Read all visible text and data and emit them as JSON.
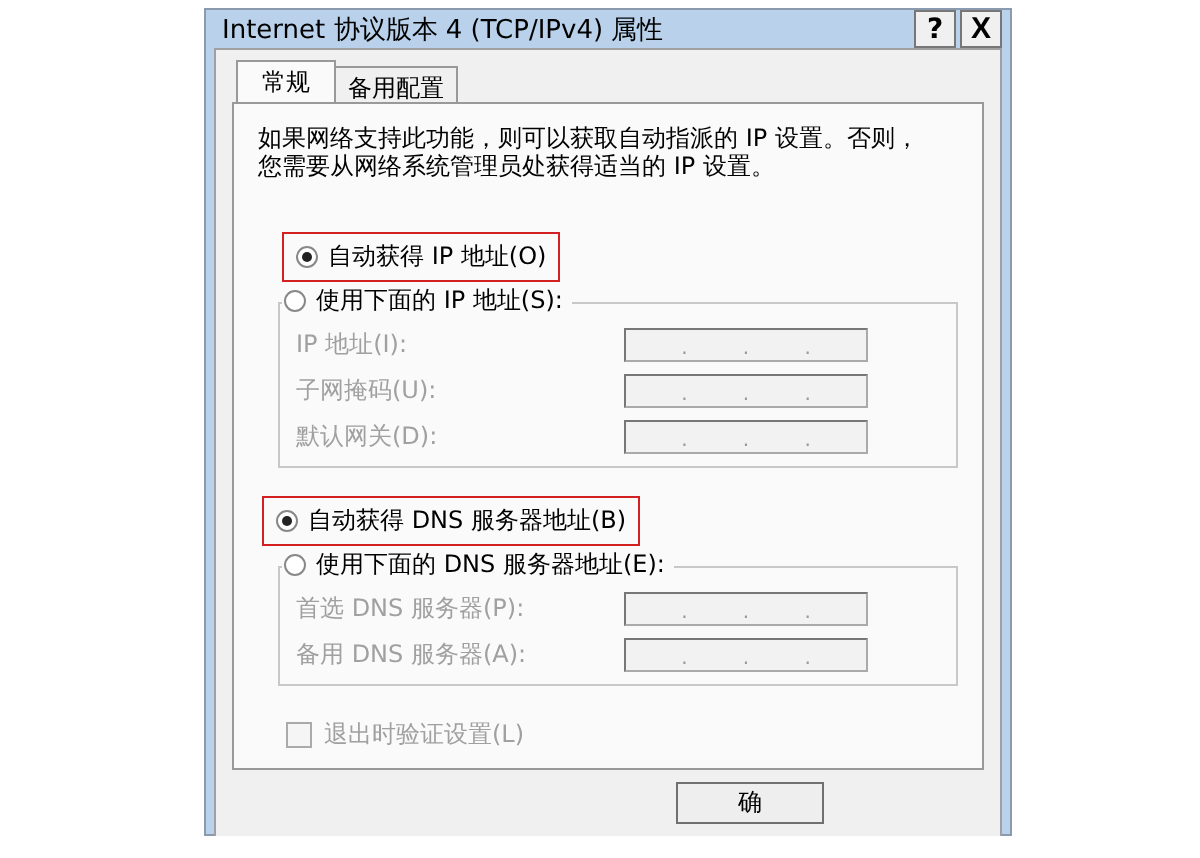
{
  "window": {
    "title": "Internet 协议版本 4 (TCP/IPv4) 属性",
    "buttons": [
      {
        "kind": "help",
        "label": "?"
      },
      {
        "kind": "close",
        "label": "X"
      }
    ]
  },
  "tabs": [
    {
      "label": "常规",
      "selected": true
    },
    {
      "label": "备用配置",
      "selected": false
    }
  ],
  "description": [
    "如果网络支持此功能，则可以获取自动指派的 IP 设置。否则，",
    "您需要从网络系统管理员处获得适当的 IP 设置。"
  ],
  "sections": [
    {
      "auto": {
        "label": "自动获得 IP 地址(O)",
        "selected": true,
        "highlighted": true
      },
      "manual": {
        "label": "使用下面的 IP 地址(S):",
        "selected": false
      },
      "fields": [
        {
          "label": "IP 地址(I):",
          "separators": [
            ".",
            ".",
            "."
          ],
          "disabled": true
        },
        {
          "label": "子网掩码(U):",
          "separators": [
            ".",
            ".",
            "."
          ],
          "disabled": true
        },
        {
          "label": "默认网关(D):",
          "separators": [
            ".",
            ".",
            "."
          ],
          "disabled": true
        }
      ]
    },
    {
      "auto": {
        "label": "自动获得 DNS 服务器地址(B)",
        "selected": true,
        "highlighted": true
      },
      "manual": {
        "label": "使用下面的 DNS 服务器地址(E):",
        "selected": false
      },
      "fields": [
        {
          "label": "首选 DNS 服务器(P):",
          "separators": [
            ".",
            ".",
            "."
          ],
          "disabled": true
        },
        {
          "label": "备用 DNS 服务器(A):",
          "separators": [
            ".",
            ".",
            "."
          ],
          "disabled": true
        }
      ]
    }
  ],
  "checkbox": {
    "label": "退出时验证设置(L)",
    "checked": false,
    "disabled": true
  },
  "footer_buttons": [
    {
      "label": "确"
    }
  ]
}
